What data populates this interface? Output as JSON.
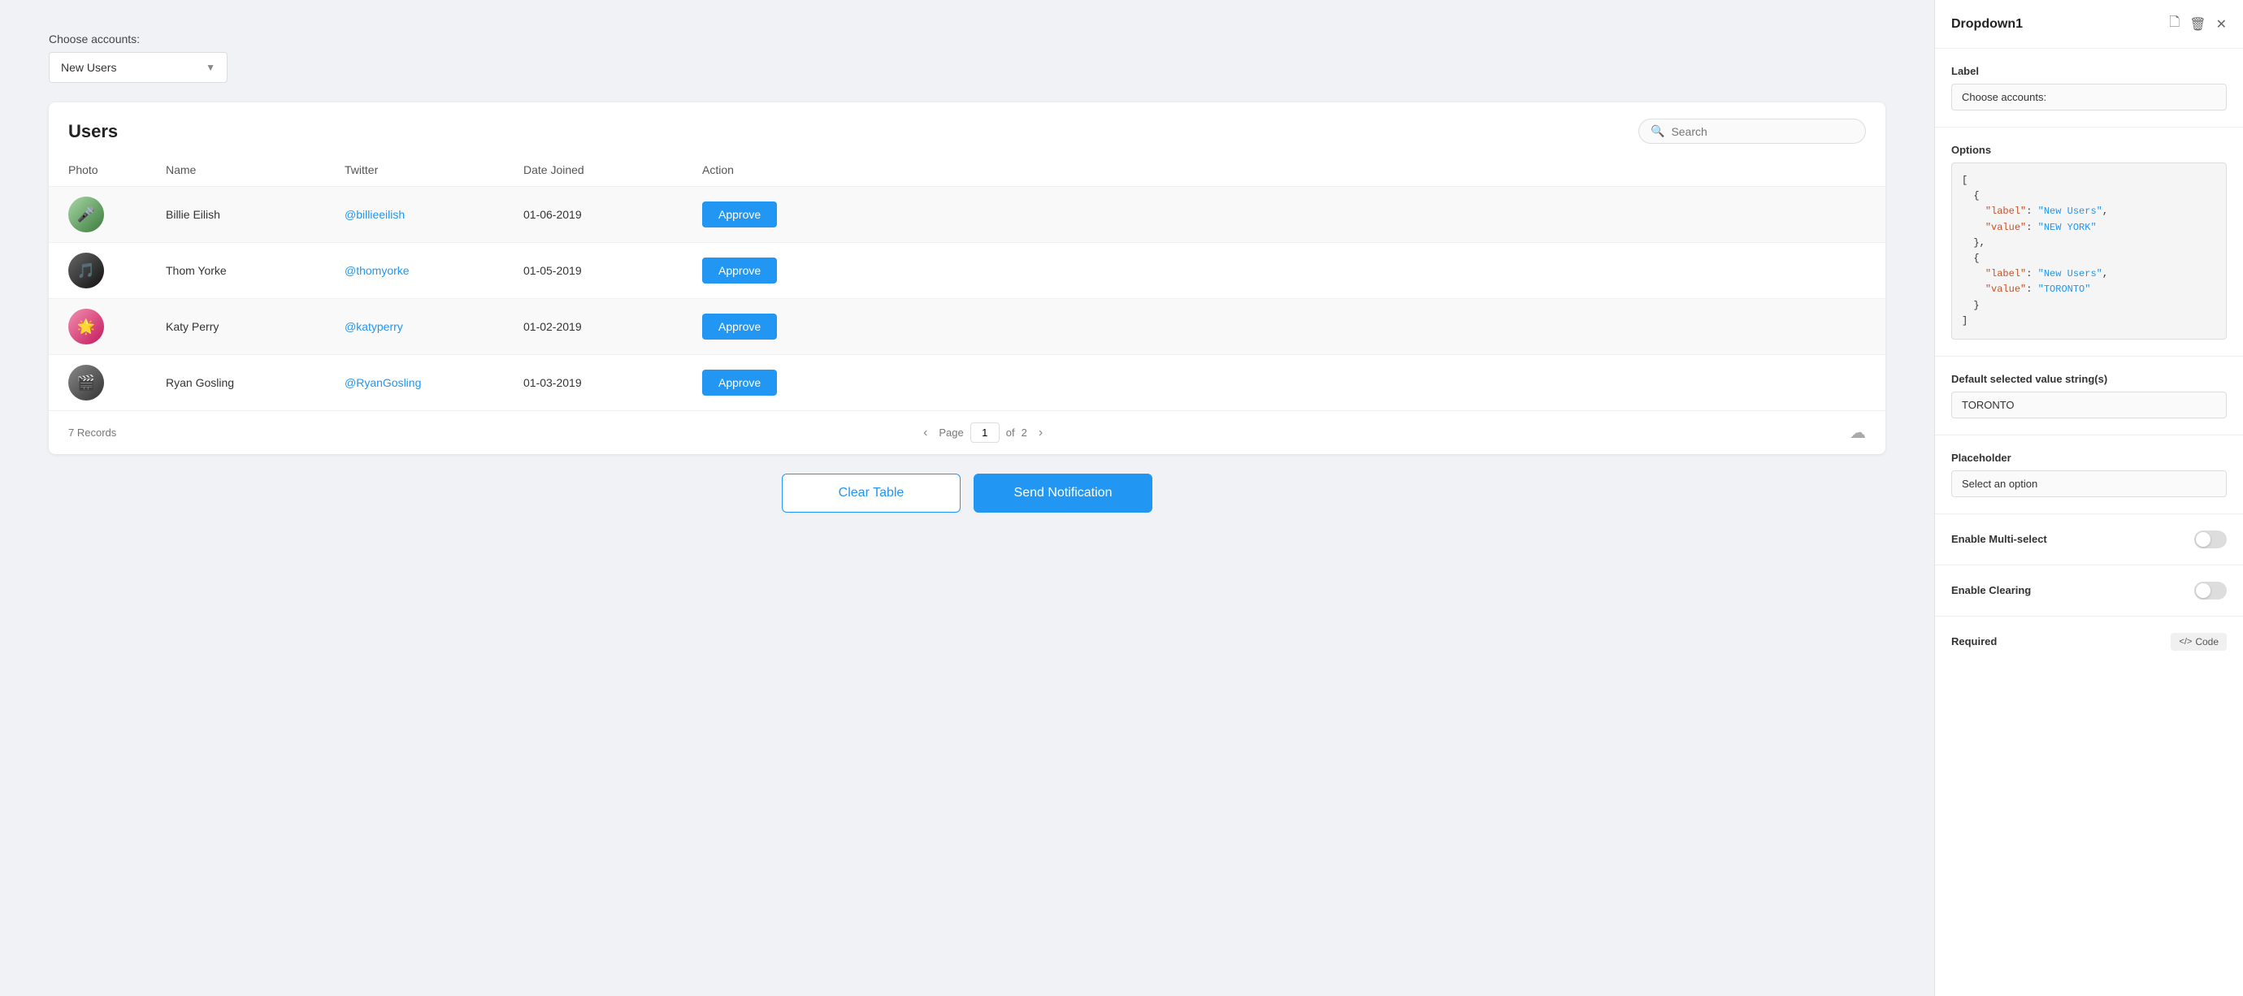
{
  "left": {
    "choose_label": "Choose accounts:",
    "dropdown_value": "New Users",
    "table": {
      "title": "Users",
      "search_placeholder": "Search",
      "columns": [
        "Photo",
        "Name",
        "Twitter",
        "Date Joined",
        "Action"
      ],
      "rows": [
        {
          "id": 1,
          "name": "Billie Eilish",
          "twitter": "@billieeilish",
          "date": "01-06-2019",
          "action": "Approve",
          "avatar_class": "billie",
          "avatar_char": "🎤"
        },
        {
          "id": 2,
          "name": "Thom Yorke",
          "twitter": "@thomyorke",
          "date": "01-05-2019",
          "action": "Approve",
          "avatar_class": "thom",
          "avatar_char": "🎵"
        },
        {
          "id": 3,
          "name": "Katy Perry",
          "twitter": "@katyperry",
          "date": "01-02-2019",
          "action": "Approve",
          "avatar_class": "katy",
          "avatar_char": "🌟"
        },
        {
          "id": 4,
          "name": "Ryan Gosling",
          "twitter": "@RyanGosling",
          "date": "01-03-2019",
          "action": "Approve",
          "avatar_class": "ryan",
          "avatar_char": "🎬"
        }
      ],
      "records": "7 Records",
      "page_label": "Page",
      "page_current": "1",
      "page_of": "of",
      "page_total": "2"
    },
    "buttons": {
      "clear_table": "Clear Table",
      "send_notification": "Send Notification"
    }
  },
  "right": {
    "panel_title": "Dropdown1",
    "label_section": {
      "label": "Label",
      "value": "Choose accounts:"
    },
    "options_section": {
      "label": "Options",
      "code": "[\n  {\n    \"label\": \"New Users\",\n    \"value\": \"NEW YORK\"\n  },\n  {\n    \"label\": \"New Users\",\n    \"value\": \"TORONTO\"\n  }\n]"
    },
    "default_section": {
      "label": "Default selected value string(s)",
      "value": "TORONTO"
    },
    "placeholder_section": {
      "label": "Placeholder",
      "value": "Select an option"
    },
    "multi_select": {
      "label": "Enable Multi-select",
      "enabled": false
    },
    "enable_clearing": {
      "label": "Enable Clearing",
      "enabled": false
    },
    "required": {
      "label": "Required",
      "code_label": "Code"
    }
  }
}
